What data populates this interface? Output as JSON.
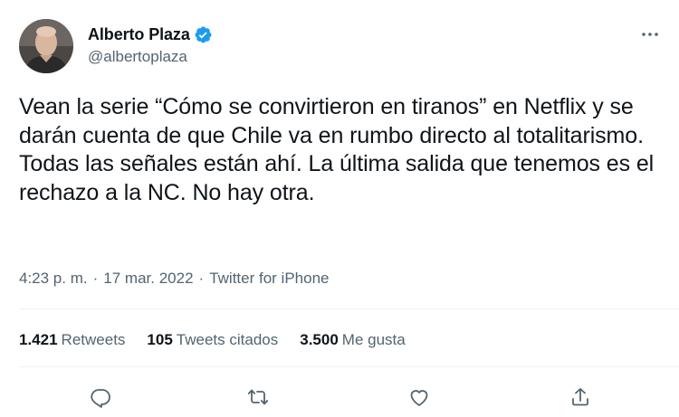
{
  "author": {
    "name": "Alberto Plaza",
    "handle": "@albertoplaza",
    "verified": true
  },
  "tweet": {
    "text": "Vean la serie “Cómo se convirtieron en tiranos” en Netflix y se darán cuenta de que Chile va en rumbo directo al totalitarismo. Todas las señales están ahí. La última salida que tenemos es el rechazo a la NC. No hay otra.",
    "time": "4:23 p. m.",
    "separator": "·",
    "date": "17 mar. 2022",
    "source": "Twitter for iPhone"
  },
  "stats": [
    {
      "value": "1.421",
      "label": "Retweets"
    },
    {
      "value": "105",
      "label": "Tweets citados"
    },
    {
      "value": "3.500",
      "label": "Me gusta"
    }
  ],
  "icons": {
    "more": "more-icon",
    "verified": "verified-badge-icon",
    "reply": "reply-icon",
    "retweet": "retweet-icon",
    "like": "heart-icon",
    "share": "share-icon"
  },
  "colors": {
    "text": "#0f1419",
    "secondary": "#536471",
    "verified": "#1d9bf0",
    "divider": "#eff3f4"
  }
}
